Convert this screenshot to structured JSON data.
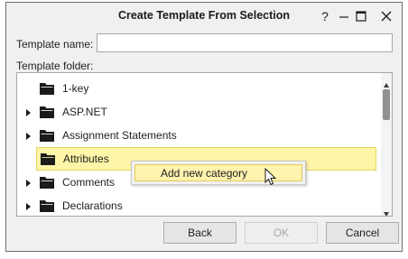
{
  "window": {
    "title": "Create Template From Selection"
  },
  "form": {
    "name_label": "Template name:",
    "name_value": "",
    "folder_label": "Template folder:"
  },
  "tree": {
    "items": [
      {
        "label": "1-key",
        "expandable": false,
        "selected": false
      },
      {
        "label": "ASP.NET",
        "expandable": true,
        "selected": false
      },
      {
        "label": "Assignment Statements",
        "expandable": true,
        "selected": false
      },
      {
        "label": "Attributes",
        "expandable": false,
        "selected": true
      },
      {
        "label": "Comments",
        "expandable": true,
        "selected": false
      },
      {
        "label": "Declarations",
        "expandable": true,
        "selected": false
      }
    ]
  },
  "context_menu": {
    "items": [
      {
        "label": "Add new category"
      }
    ]
  },
  "buttons": {
    "back": "Back",
    "ok": "OK",
    "cancel": "Cancel"
  }
}
